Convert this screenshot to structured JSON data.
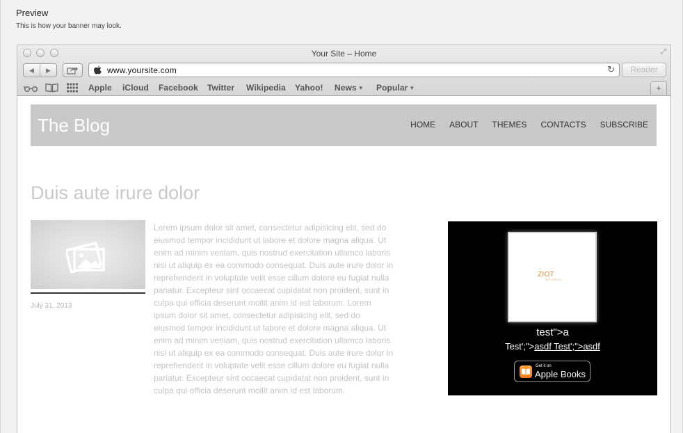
{
  "preview": {
    "title": "Preview",
    "subtitle": "This is how your banner may look."
  },
  "browser": {
    "window_title": "Your Site – Home",
    "url": "www.yoursite.com",
    "reader_label": "Reader",
    "bookmarks": [
      "Apple",
      "iCloud",
      "Facebook",
      "Twitter",
      "Wikipedia",
      "Yahoo!",
      "News",
      "Popular"
    ],
    "icons": [
      "back-icon",
      "forward-icon",
      "share-icon",
      "apple-icon",
      "reload-icon",
      "reading-list-icon",
      "bookmarks-icon",
      "top-sites-icon",
      "new-tab-icon",
      "fullscreen-icon"
    ]
  },
  "site": {
    "title": "The Blog",
    "nav": [
      "HOME",
      "ABOUT",
      "THEMES",
      "CONTACTS",
      "SUBSCRIBE"
    ],
    "header_color": "#c9c9c9"
  },
  "post": {
    "title": "Duis aute irure dolor",
    "date": "July 31, 2013",
    "body": "Lorem ipsum dolor sit amet, consectetur adipisicing elit, sed do eiusmod tempor incididunt ut labore et dolore magna aliqua. Ut enim ad minim veniam, quis nostrud exercitation ullamco laboris nisi ut aliquip ex ea commodo consequat. Duis aute irure dolor in reprehenderit in voluptate velit esse cillum dolore eu fugiat nulla pariatur. Excepteur sint occaecat cupidatat non proident, sunt in culpa qui officia deserunt mollit anim id est laborum. Lorem ipsum dolor sit amet, consectetur adipisicing elit, sed do eiusmod tempor incididunt ut labore et dolore magna aliqua. Ut enim ad minim veniam, quis nostrud exercitation ullamco laboris nisi ut aliquip ex ea commodo consequat. Duis aute irure dolor in reprehenderit in voluptate velit esse cillum dolore eu fugiat nulla pariatur. Excepteur sint occaecat cupidatat non proident, sunt in culpa qui officia deserunt mollit anim id est laborum."
  },
  "ad": {
    "logo_text": "ZIOT",
    "logo_subtext": "SECURITY",
    "line1": "test\">a",
    "line2_prefix": "Test';\">",
    "line2_link": "asdf Test';\">asdf",
    "badge_small": "Get it on",
    "badge_big": "Apple Books",
    "badge_color": "#f27b1d"
  }
}
